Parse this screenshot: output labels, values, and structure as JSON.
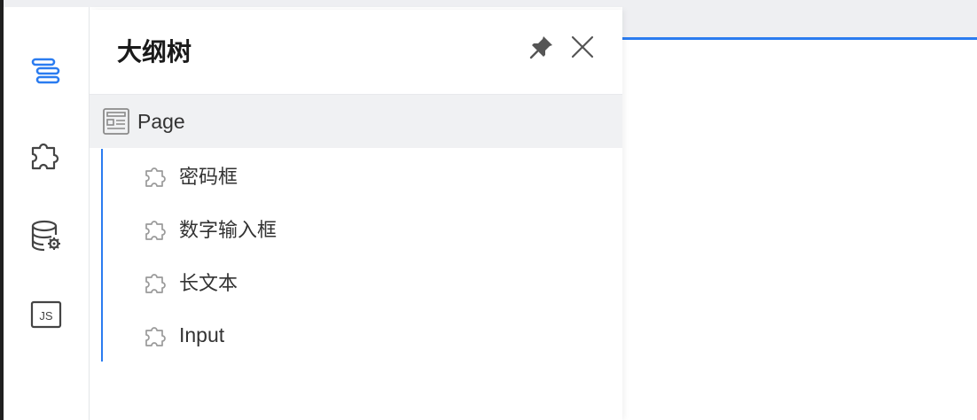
{
  "panel": {
    "title": "大纲树",
    "pin_icon": "pin-icon",
    "close_icon": "close-icon"
  },
  "rail": {
    "items": [
      {
        "icon": "outline-tree-icon",
        "active": true
      },
      {
        "icon": "component-puzzle-icon",
        "active": false
      },
      {
        "icon": "datasource-icon",
        "active": false
      },
      {
        "icon": "js-code-icon",
        "active": false
      }
    ]
  },
  "tree": {
    "root": {
      "label": "Page",
      "icon": "page-icon"
    },
    "children": [
      {
        "label": "密码框",
        "icon": "component-icon"
      },
      {
        "label": "数字输入框",
        "icon": "component-icon"
      },
      {
        "label": "长文本",
        "icon": "component-icon"
      },
      {
        "label": "Input",
        "icon": "component-icon"
      }
    ]
  },
  "colors": {
    "accent": "#2b7cf0",
    "selected_row_bg": "#f0f1f3",
    "text": "#333333",
    "icon_muted": "#999999"
  }
}
